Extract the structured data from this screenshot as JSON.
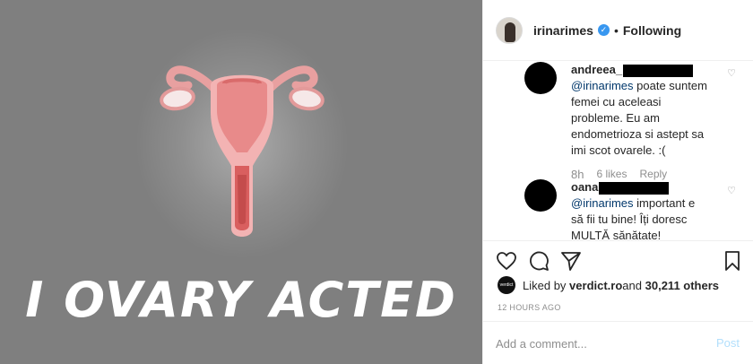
{
  "media": {
    "caption": "I OVARY ACTED",
    "background_color": "#7f7f7f",
    "illustration": "uterus-illustration"
  },
  "header": {
    "username": "irinarimes",
    "verified_icon": "verified-badge-icon",
    "separator": "•",
    "follow_status": "Following"
  },
  "comments": [
    {
      "username": "andreea_",
      "mention": "@irinarimes",
      "text": " poate suntem femei cu aceleasi probleme. Eu am endometrioza si astept sa imi scot ovarele. :(",
      "time": "8h",
      "likes": "6 likes",
      "reply": "Reply"
    },
    {
      "username": "oana",
      "mention": "@irinarimes",
      "text": " important e să fii tu bine! Îți doresc MULTĂ sănătate!"
    }
  ],
  "actions": {
    "like_icon": "heart-icon",
    "comment_icon": "comment-icon",
    "share_icon": "share-icon",
    "save_icon": "bookmark-icon"
  },
  "likes": {
    "mini_avatar_text": "verdict",
    "prefix": "Liked by ",
    "user": "verdict.ro",
    "middle": " and ",
    "count": "30,211 others"
  },
  "timestamp": "12 HOURS AGO",
  "add_comment": {
    "placeholder": "Add a comment...",
    "post_label": "Post"
  },
  "colors": {
    "link": "#00376b",
    "verified": "#3897f0",
    "post_disabled": "#b2dffc",
    "muted": "#8e8e8e"
  }
}
